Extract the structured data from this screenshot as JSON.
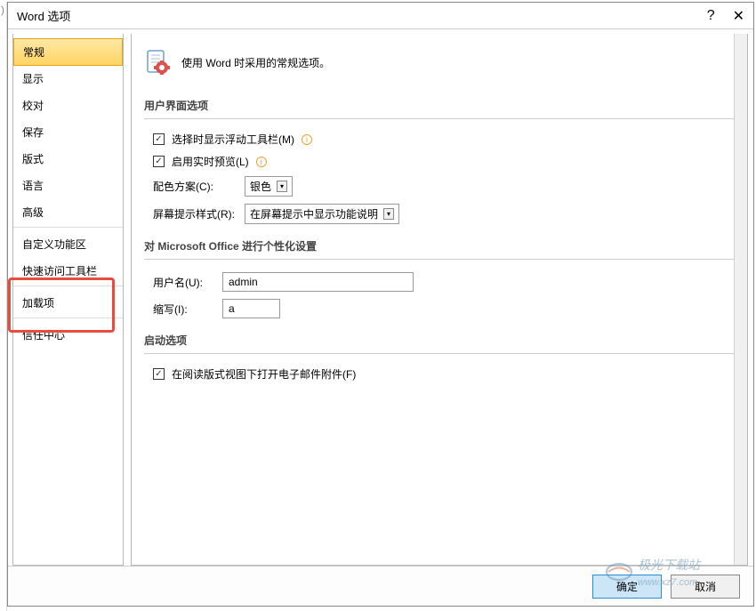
{
  "titlebar": {
    "title": "Word 选项",
    "help": "?",
    "close": "✕"
  },
  "sidebar": {
    "items": [
      {
        "label": "常规"
      },
      {
        "label": "显示"
      },
      {
        "label": "校对"
      },
      {
        "label": "保存"
      },
      {
        "label": "版式"
      },
      {
        "label": "语言"
      },
      {
        "label": "高级"
      },
      {
        "label": "自定义功能区"
      },
      {
        "label": "快速访问工具栏"
      },
      {
        "label": "加载项"
      },
      {
        "label": "信任中心"
      }
    ]
  },
  "main": {
    "header_text": "使用 Word 时采用的常规选项。",
    "section1": {
      "title": "用户界面选项",
      "opt1": "选择时显示浮动工具栏(M)",
      "opt2": "启用实时预览(L)",
      "color_scheme_label": "配色方案(C):",
      "color_scheme_value": "银色",
      "tooltip_style_label": "屏幕提示样式(R):",
      "tooltip_style_value": "在屏幕提示中显示功能说明"
    },
    "section2": {
      "title": "对 Microsoft Office 进行个性化设置",
      "username_label": "用户名(U):",
      "username_value": "admin",
      "initials_label": "缩写(I):",
      "initials_value": "a"
    },
    "section3": {
      "title": "启动选项",
      "opt1": "在阅读版式视图下打开电子邮件附件(F)"
    }
  },
  "footer": {
    "ok": "确定",
    "cancel": "取消"
  },
  "watermark": {
    "text": "极光下载站",
    "url": "www.xz7.com"
  }
}
